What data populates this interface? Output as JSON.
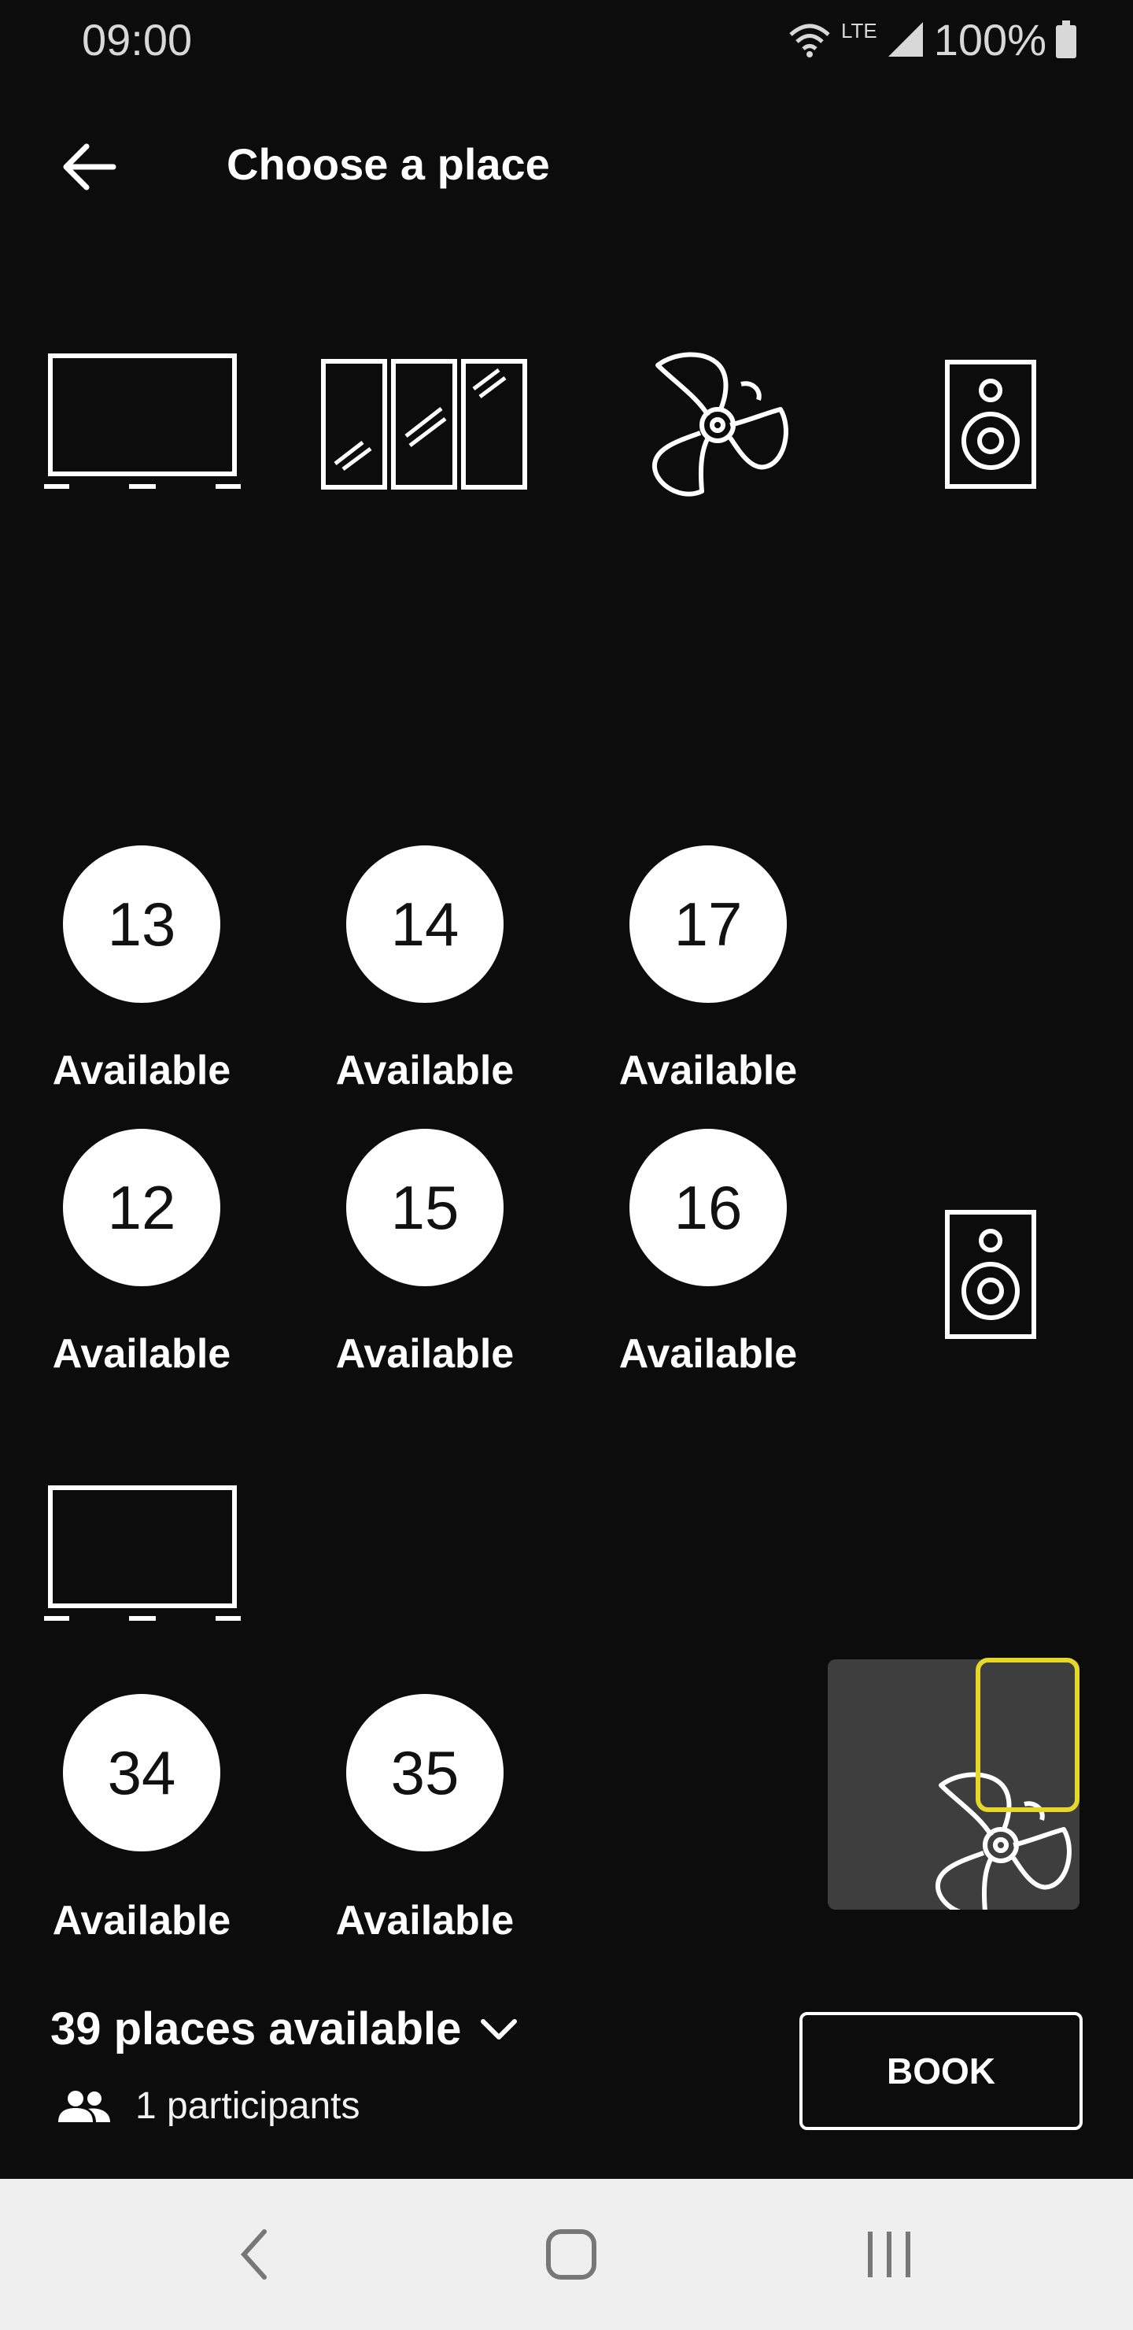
{
  "status_bar": {
    "time": "09:00",
    "network": "LTE",
    "battery": "100%"
  },
  "header": {
    "title": "Choose a place"
  },
  "seats": [
    {
      "number": "13",
      "status": "Available"
    },
    {
      "number": "14",
      "status": "Available"
    },
    {
      "number": "17",
      "status": "Available"
    },
    {
      "number": "12",
      "status": "Available"
    },
    {
      "number": "15",
      "status": "Available"
    },
    {
      "number": "16",
      "status": "Available"
    },
    {
      "number": "34",
      "status": "Available"
    },
    {
      "number": "35",
      "status": "Available"
    }
  ],
  "footer": {
    "places_available": "39 places available",
    "participants": "1 participants",
    "book_label": "BOOK"
  },
  "colors": {
    "background": "#0c0c0c",
    "seat": "#ffffff",
    "minimap_viewport": "#e6d82a"
  },
  "icons": [
    "tv-icon",
    "window-icon",
    "fan-icon",
    "speaker-icon",
    "arrow-left-icon",
    "chevron-down-icon",
    "people-icon"
  ]
}
